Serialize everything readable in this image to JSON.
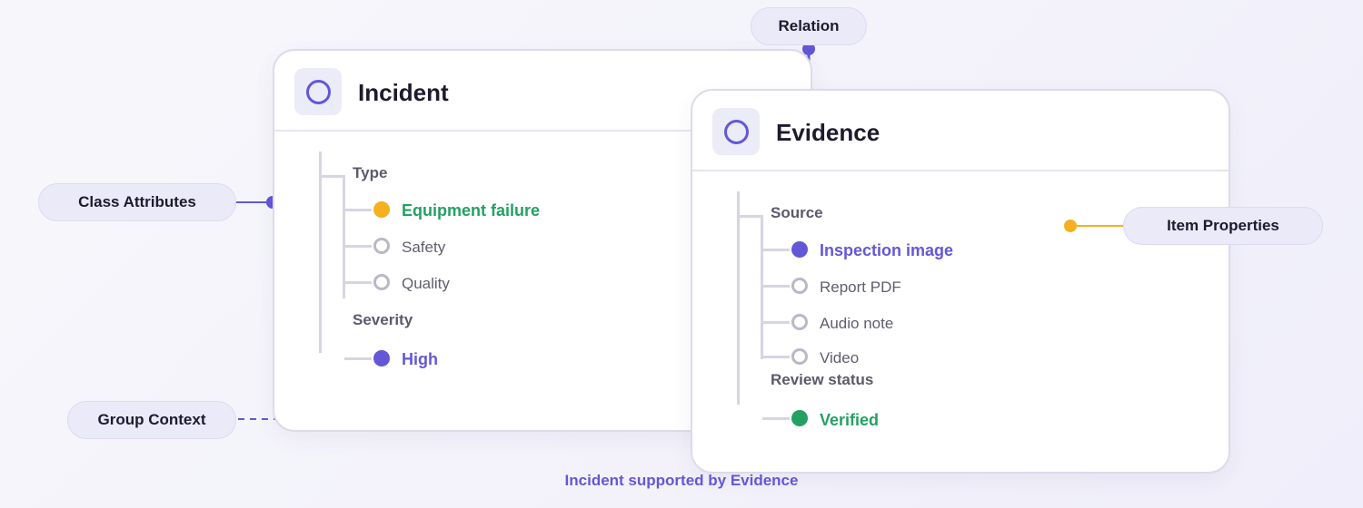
{
  "colors": {
    "accent": "#6357d8",
    "selected_green": "#24a063",
    "warning_orange": "#f4b01e",
    "empty_circle": "#b9b8c7"
  },
  "callouts": {
    "relation": "Relation",
    "class_attributes": "Class Attributes",
    "item_properties": "Item Properties",
    "group_context": "Group Context"
  },
  "cards": {
    "incident": {
      "title": "Incident",
      "icon": "circle-icon",
      "groups": [
        {
          "label": "Type",
          "items": [
            {
              "label": "Equipment failure",
              "selected": true,
              "dot_color": "#f4b01e",
              "text_color": "#24a063"
            },
            {
              "label": "Safety",
              "selected": false
            },
            {
              "label": "Quality",
              "selected": false
            }
          ]
        },
        {
          "label": "Severity",
          "items": [
            {
              "label": "High",
              "selected": true,
              "dot_color": "#6357d8",
              "text_color": "#6357d8"
            }
          ]
        }
      ]
    },
    "evidence": {
      "title": "Evidence",
      "icon": "circle-icon",
      "groups": [
        {
          "label": "Source",
          "items": [
            {
              "label": "Inspection image",
              "selected": true,
              "dot_color": "#6357d8",
              "text_color": "#6357d8"
            },
            {
              "label": "Report PDF",
              "selected": false
            },
            {
              "label": "Audio note",
              "selected": false
            },
            {
              "label": "Video",
              "selected": false
            }
          ]
        },
        {
          "label": "Review status",
          "items": [
            {
              "label": "Verified",
              "selected": true,
              "dot_color": "#24a063",
              "text_color": "#24a063"
            }
          ]
        }
      ]
    }
  },
  "caption": "Incident supported by Evidence"
}
